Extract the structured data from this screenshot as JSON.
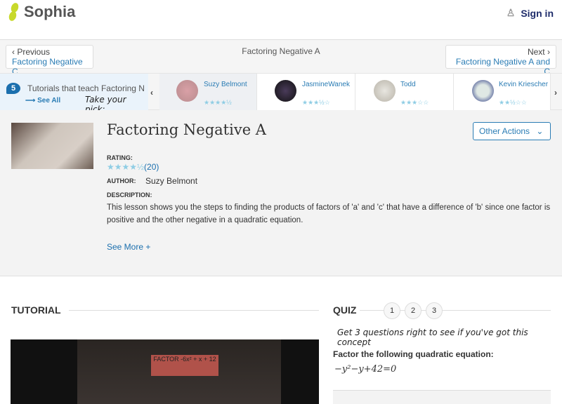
{
  "header": {
    "logo": "Sophia",
    "signin": "Sign in"
  },
  "nav": {
    "prev_label": "Previous",
    "prev_link": "Factoring Negative C",
    "title": "Factoring Negative A",
    "next_label": "Next",
    "next_link": "Factoring Negative A and C"
  },
  "carousel": {
    "count": "5",
    "heading": "Tutorials that teach Factoring Negative A",
    "see_all": "See All",
    "pick": "Take your pick:",
    "cards": [
      {
        "name": "Suzy Belmont",
        "rating": 4.5,
        "stars": "★★★★½"
      },
      {
        "name": "JasmineWanek",
        "rating": 3.5,
        "stars": "★★★½☆"
      },
      {
        "name": "Todd",
        "rating": 3,
        "stars": "★★★☆☆"
      },
      {
        "name": "Kevin Kriescher",
        "rating": 2.5,
        "stars": "★★½☆☆"
      }
    ]
  },
  "details": {
    "title": "Factoring Negative A",
    "other_actions": "Other Actions",
    "rating_label": "RATING:",
    "rating": 4.5,
    "stars": "★★★★½",
    "rating_count": "(20)",
    "author_label": "AUTHOR:",
    "author": "Suzy Belmont",
    "description_label": "DESCRIPTION:",
    "description": "This lesson shows you the steps to finding the products of factors of 'a' and 'c' that have a difference of 'b' since one factor is positive and the other negative in a quadratic equation.",
    "see_more": "See More +"
  },
  "tutorial": {
    "heading": "TUTORIAL",
    "video_text": "FACTOR -6x² + x + 12"
  },
  "quiz": {
    "heading": "QUIZ",
    "steps": [
      "1",
      "2",
      "3"
    ],
    "prompt": "Get 3 questions right to see if you've got this concept",
    "question": "Factor the following quadratic equation:",
    "equation": "−y²−y+42=0"
  }
}
